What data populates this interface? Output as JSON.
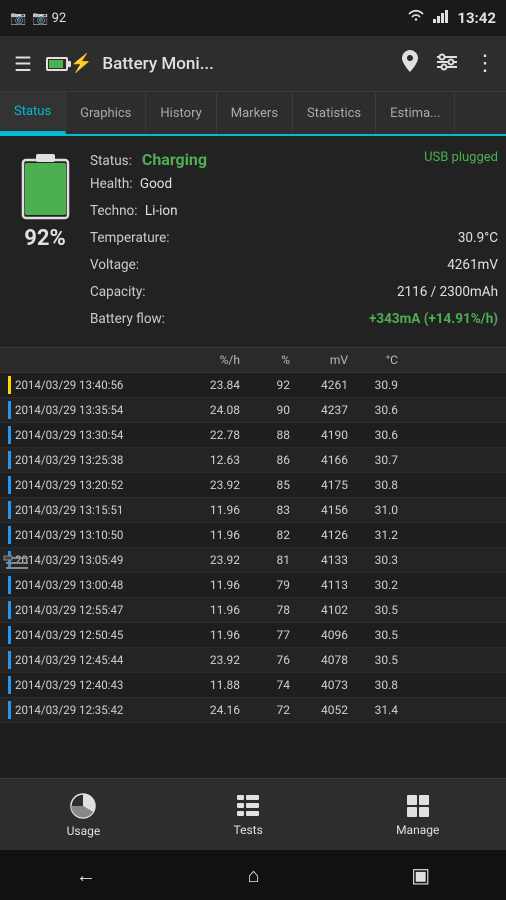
{
  "statusBar": {
    "leftIcons": "📷 92",
    "time": "13:42",
    "wifi": "WiFi",
    "signal": "Signal"
  },
  "toolbar": {
    "title": "Battery Moni...",
    "menuIcon": "☰",
    "locationIcon": "📍",
    "filterIcon": "⚡",
    "moreIcon": "⋮"
  },
  "tabs": [
    {
      "label": "Status",
      "active": true
    },
    {
      "label": "Graphics",
      "active": false
    },
    {
      "label": "History",
      "active": false
    },
    {
      "label": "Markers",
      "active": false
    },
    {
      "label": "Statistics",
      "active": false
    },
    {
      "label": "Estima...",
      "active": false
    }
  ],
  "statusPanel": {
    "percent": "92%",
    "statusLabel": "Status:",
    "statusValue": "Charging",
    "usbLabel": "USB plugged",
    "healthLabel": "Health:",
    "healthValue": "Good",
    "technoLabel": "Techno:",
    "technoValue": "Li-ion",
    "tempLabel": "Temperature:",
    "tempValue": "30.9°C",
    "voltLabel": "Voltage:",
    "voltValue": "4261mV",
    "capLabel": "Capacity:",
    "capValue": "2116 / 2300mAh",
    "flowLabel": "Battery flow:",
    "flowValue": "+343mA (+14.91%/h)"
  },
  "tableHeader": {
    "dateTime": "",
    "ratePerH": "%/h",
    "percent": "%",
    "mv": "mV",
    "celsius": "°C"
  },
  "tableRows": [
    {
      "datetime": "2014/03/29  13:40:56",
      "rph": "23.84",
      "pct": "92",
      "mv": "4261",
      "temp": "30.9",
      "indicator": "yellow"
    },
    {
      "datetime": "2014/03/29  13:35:54",
      "rph": "24.08",
      "pct": "90",
      "mv": "4237",
      "temp": "30.6",
      "indicator": "blue"
    },
    {
      "datetime": "2014/03/29  13:30:54",
      "rph": "22.78",
      "pct": "88",
      "mv": "4190",
      "temp": "30.6",
      "indicator": "blue"
    },
    {
      "datetime": "2014/03/29  13:25:38",
      "rph": "12.63",
      "pct": "86",
      "mv": "4166",
      "temp": "30.7",
      "indicator": "blue"
    },
    {
      "datetime": "2014/03/29  13:20:52",
      "rph": "23.92",
      "pct": "85",
      "mv": "4175",
      "temp": "30.8",
      "indicator": "blue"
    },
    {
      "datetime": "2014/03/29  13:15:51",
      "rph": "11.96",
      "pct": "83",
      "mv": "4156",
      "temp": "31.0",
      "indicator": "blue"
    },
    {
      "datetime": "2014/03/29  13:10:50",
      "rph": "11.96",
      "pct": "82",
      "mv": "4126",
      "temp": "31.2",
      "indicator": "blue"
    },
    {
      "datetime": "2014/03/29  13:05:49",
      "rph": "23.92",
      "pct": "81",
      "mv": "4133",
      "temp": "30.3",
      "indicator": "blue"
    },
    {
      "datetime": "2014/03/29  13:00:48",
      "rph": "11.96",
      "pct": "79",
      "mv": "4113",
      "temp": "30.2",
      "indicator": "blue"
    },
    {
      "datetime": "2014/03/29  12:55:47",
      "rph": "11.96",
      "pct": "78",
      "mv": "4102",
      "temp": "30.5",
      "indicator": "blue"
    },
    {
      "datetime": "2014/03/29  12:50:45",
      "rph": "11.96",
      "pct": "77",
      "mv": "4096",
      "temp": "30.5",
      "indicator": "blue"
    },
    {
      "datetime": "2014/03/29  12:45:44",
      "rph": "23.92",
      "pct": "76",
      "mv": "4078",
      "temp": "30.5",
      "indicator": "blue"
    },
    {
      "datetime": "2014/03/29  12:40:43",
      "rph": "11.88",
      "pct": "74",
      "mv": "4073",
      "temp": "30.8",
      "indicator": "blue"
    },
    {
      "datetime": "2014/03/29  12:35:42",
      "rph": "24.16",
      "pct": "72",
      "mv": "4052",
      "temp": "31.4",
      "indicator": "blue"
    }
  ],
  "bottomNav": {
    "usage": "Usage",
    "tests": "Tests",
    "manage": "Manage"
  },
  "systemNav": {
    "back": "←",
    "home": "⌂",
    "recent": "▣"
  }
}
